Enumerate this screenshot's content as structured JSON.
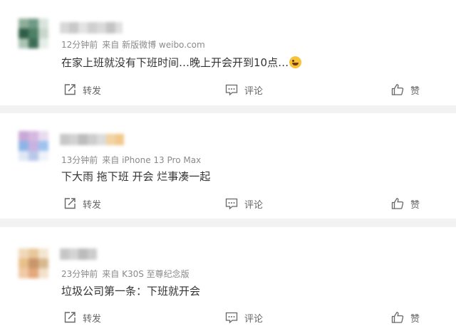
{
  "comments": [
    {
      "time": "12分钟前",
      "source": "来自 新版微博 weibo.com",
      "text": "在家上班就没有下班时间…晚上开会开到10点…",
      "emoji": "grinning-sweat-emoji",
      "actions": {
        "repost": "转发",
        "comment": "评论",
        "like": "赞"
      },
      "avatar_colors": [
        "#8fae9a",
        "#6f9a86",
        "#d9e4dd",
        "#2f5e48",
        "#4e8067",
        "#c8d6cc",
        "#aac3b4",
        "#3d6c55",
        "#e6eee9"
      ],
      "username_colors": [
        "#d8d8d8",
        "#c9c9c9",
        "#e3e3e3",
        "#cfcfcf",
        "#dadada",
        "#c4c4c4",
        "#e0e0e0"
      ]
    },
    {
      "time": "13分钟前",
      "source": "来自 iPhone 13 Pro Max",
      "text": "下大雨 拖下班 开会 烂事凑一起",
      "emoji": "",
      "actions": {
        "repost": "转发",
        "comment": "评论",
        "like": "赞"
      },
      "avatar_colors": [
        "#c9a8d6",
        "#d6b9e0",
        "#e9dcef",
        "#8fb4e6",
        "#c7b3e0",
        "#9fc3ef",
        "#dfe8f5",
        "#b9c8ea",
        "#eef2fa"
      ],
      "username_colors": [
        "#c8c8c8",
        "#d2d2d2",
        "#bdbdbd",
        "#cdcdcd",
        "#dcdcdc",
        "#f1d3a4",
        "#f0c98a"
      ]
    },
    {
      "time": "23分钟前",
      "source": "来自 K30S 至尊纪念版",
      "text": "垃圾公司第一条：下班就开会",
      "emoji": "",
      "actions": {
        "repost": "转发",
        "comment": "评论",
        "like": "赞"
      },
      "avatar_colors": [
        "#efd9b8",
        "#e8c79a",
        "#f4e6d1",
        "#e8c08a",
        "#c9956a",
        "#d8b98f",
        "#f0c9a6",
        "#e4a87c",
        "#f3e1cc"
      ],
      "username_colors": [
        "#c6c6c6",
        "#d4d4d4",
        "#bcbcbc",
        "#cccccc",
        "#d9d9d9"
      ]
    }
  ],
  "colors": {
    "background": "#f2f2f2",
    "card": "#ffffff",
    "text": "#333333",
    "meta": "#8a8a8a",
    "action": "#666666"
  },
  "icons": {
    "repost": "repost-icon",
    "comment": "comment-icon",
    "like": "thumbs-up-icon"
  }
}
